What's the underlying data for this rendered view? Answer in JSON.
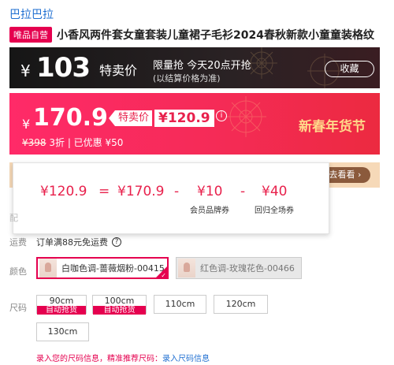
{
  "brand": "巴拉巴拉",
  "title_tag": "唯品自营",
  "title": "小香风两件套女童套装儿童裙子毛衫2024春秋新款小童童装格纹",
  "flash": {
    "currency": "¥",
    "price": "103",
    "label": "特卖价",
    "hint1": "限量抢 今天20点开抢",
    "hint2": "(以结算价格为准)",
    "collect": "收藏"
  },
  "pink": {
    "currency": "¥",
    "price": "170.9",
    "sale_label": "特卖价",
    "sale_price": "¥120.9",
    "info_icon": "ⓘ",
    "orig_price": "¥398",
    "discount_text": "3折 | 已优惠 ¥50",
    "festival": "新春年货节"
  },
  "coupon_button": "去看看",
  "popup": {
    "result": "¥120.9",
    "equals": "=",
    "base": "¥170.9",
    "minus1": "-",
    "c1": "¥10",
    "minus2": "-",
    "c2": "¥40",
    "c1_label": "会员品牌券",
    "c2_label": "回归全场券"
  },
  "hidden_label_fragment": "配",
  "shipping": {
    "label": "运费",
    "text": "订单满88元免运费"
  },
  "color": {
    "label": "颜色",
    "options": [
      {
        "name": "白咖色调-蔷薇烟粉-00415",
        "selected": true
      },
      {
        "name": "红色调-玫瑰花色-00466",
        "selected": false
      }
    ]
  },
  "size": {
    "label": "尺码",
    "options": [
      {
        "name": "90cm",
        "tag": "自动抢货"
      },
      {
        "name": "100cm",
        "tag": "自动抢货"
      },
      {
        "name": "110cm",
        "tag": ""
      },
      {
        "name": "120cm",
        "tag": ""
      },
      {
        "name": "130cm",
        "tag": ""
      }
    ]
  },
  "footer": {
    "text": "录入您的尺码信息，精准推荐尺码：",
    "link": "录入尺码信息"
  },
  "colors": {
    "accent": "#e5004f",
    "link": "#1f6fd1",
    "pink_banner": "#f52b57",
    "dark_banner": "#1c1c1c"
  }
}
